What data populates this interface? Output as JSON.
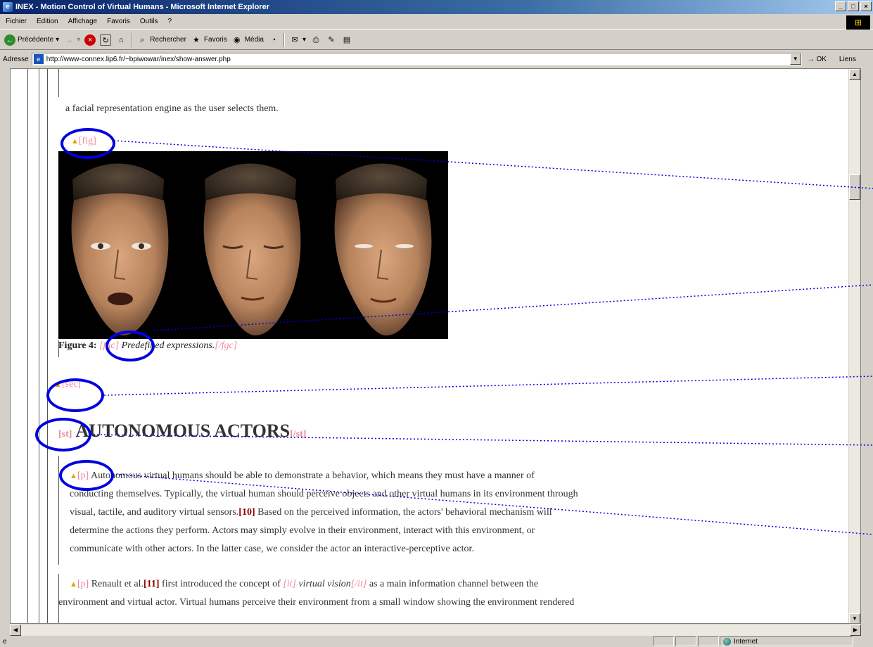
{
  "window": {
    "title": "INEX - Motion Control of Virtual Humans - Microsoft Internet Explorer",
    "buttons": {
      "minimize": "_",
      "maximize": "□",
      "close": "×"
    }
  },
  "menu": [
    "Fichier",
    "Edition",
    "Affichage",
    "Favoris",
    "Outils",
    "?"
  ],
  "toolbar": {
    "back": "Précédente",
    "search": "Rechercher",
    "favorites": "Favoris",
    "media": "Média"
  },
  "address": {
    "label": "Adresse",
    "url": "http://www-connex.lip6.fr/~bpiwowar/inex/show-answer.php",
    "go": "OK",
    "links": "Liens"
  },
  "content": {
    "intro_line": "a facial representation engine as the user selects them.",
    "fig_tag": "[fig]",
    "caption": {
      "label": "Figure 4:",
      "open_tag": "[fgc]",
      "title": "Predefined expressions.",
      "close_tag": "[/fgc]"
    },
    "sec_tag": "[sec]",
    "heading": {
      "open_tag": "[st]",
      "text": "AUTONOMOUS ACTORS",
      "close_tag": "[/st]"
    },
    "para1": {
      "tag": "[p]",
      "line1": "Autonomous virtual humans should be able to demonstrate a behavior, which means they must have a manner of",
      "line2": "conducting themselves. Typically, the virtual human should perceive objects and other virtual humans in its environment through",
      "line3a": "visual, tactile, and auditory virtual sensors.",
      "cite": "[10]",
      "line3b": " Based on the perceived information, the actors' behavioral mechanism will",
      "line4": "determine the actions they perform. Actors may simply evolve in their environment, interact with this environment, or",
      "line5": "communicate with other actors. In the latter case, we consider the actor an interactive-perceptive actor."
    },
    "para2": {
      "tag": "[p]",
      "text_a": " Renault et al.",
      "cite": "[11]",
      "text_b": " first introduced the concept of ",
      "it_open": "[it]",
      "it_text": " virtual vision",
      "it_close": "[/it]",
      "text_c": " as a main information channel between the",
      "line2": "environment and virtual actor. Virtual humans perceive their environment from a small window showing the environment rendered"
    }
  },
  "status": {
    "zone": "Internet"
  },
  "colors": {
    "annotation": "#0000e0",
    "tag": "#f08a9a",
    "arrow": "#e8a000"
  }
}
